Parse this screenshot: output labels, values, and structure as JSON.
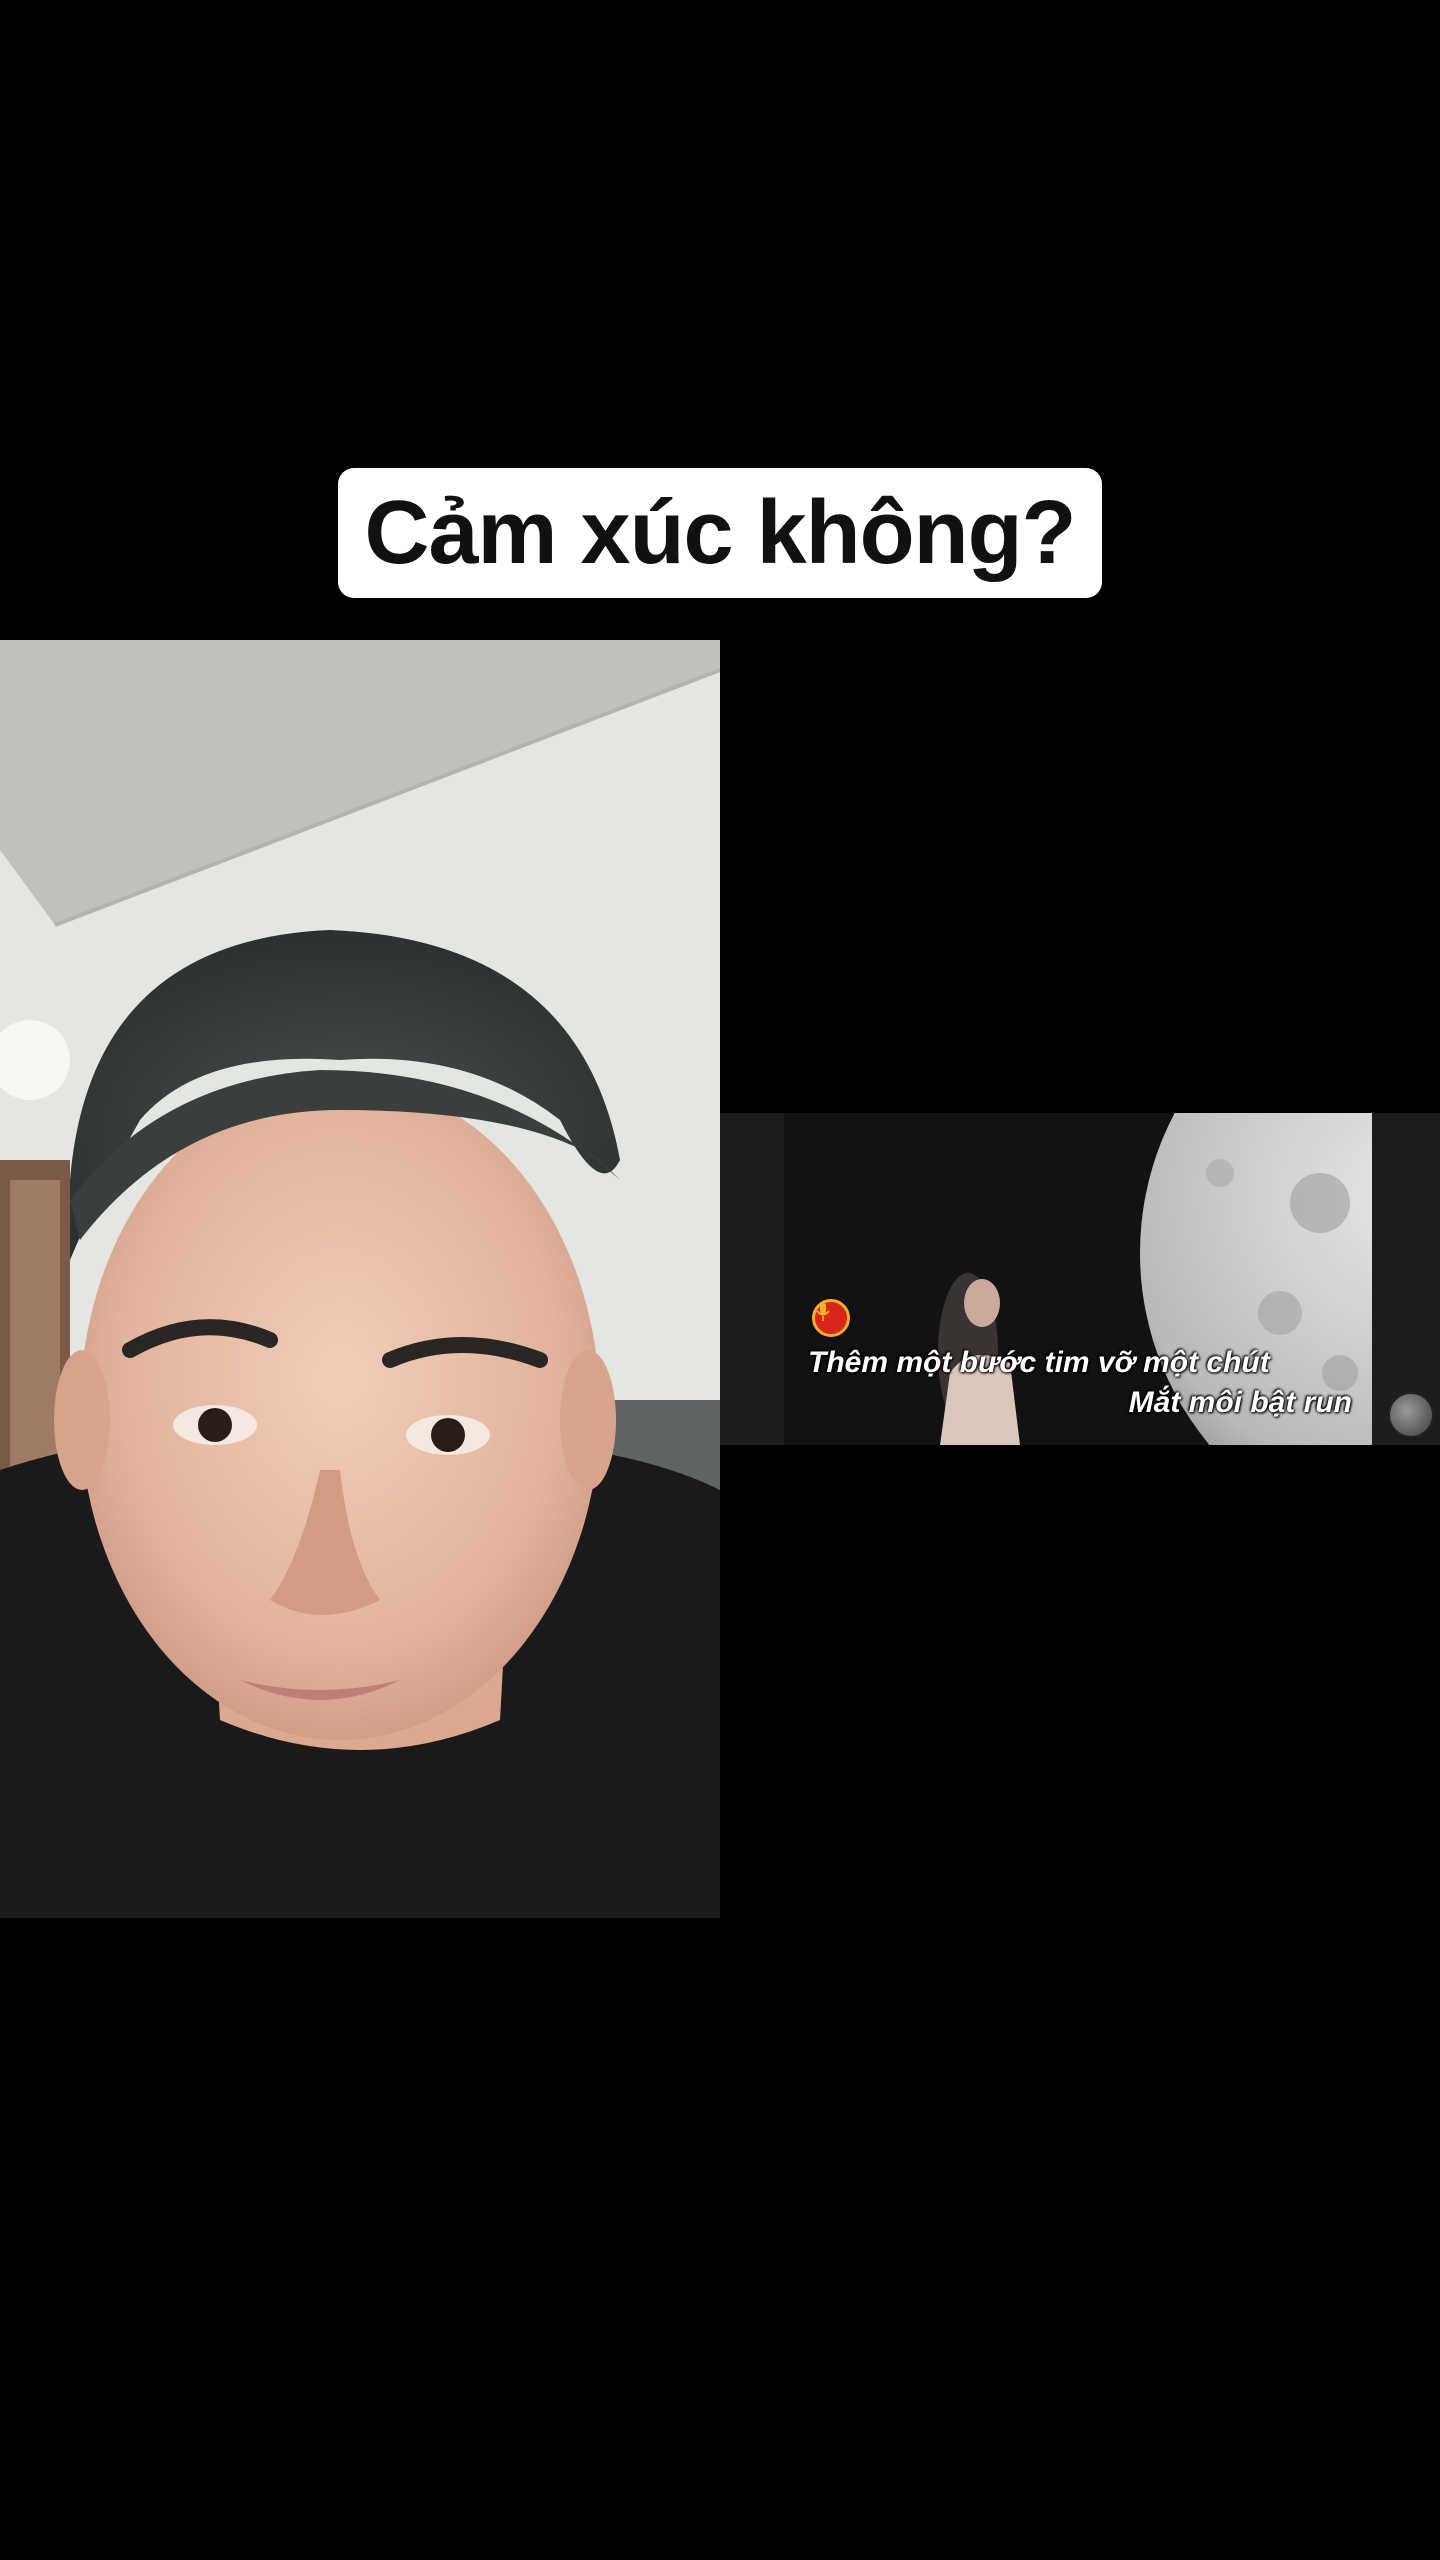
{
  "title": "Cảm xúc không?",
  "clip": {
    "lyric_line_1": "Thêm một bước tim vỡ một chút",
    "lyric_line_2": "Mắt môi bật run",
    "mic_icon": "microphone-icon"
  },
  "colors": {
    "background": "#000000",
    "title_box": "#ffffff",
    "title_text": "#111111",
    "lyrics": "#ffffff",
    "mic_badge": "#d8261c"
  }
}
